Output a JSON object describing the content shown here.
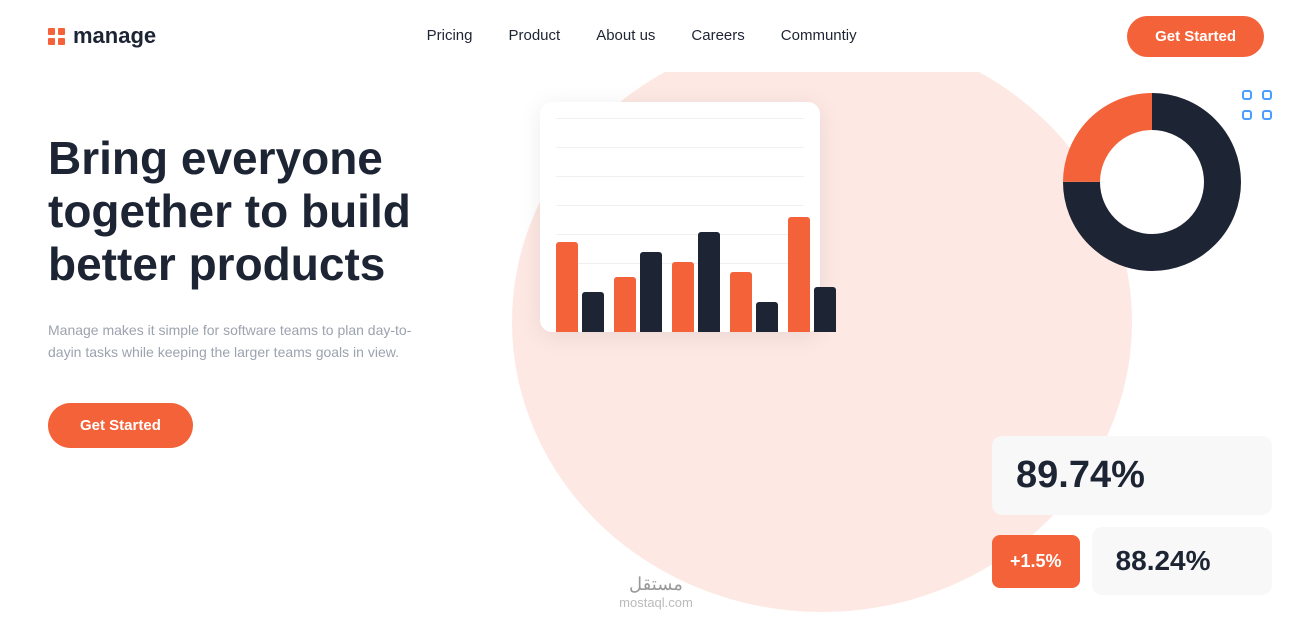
{
  "logo": {
    "text": "manage"
  },
  "navbar": {
    "links": [
      {
        "label": "Pricing",
        "id": "pricing"
      },
      {
        "label": "Product",
        "id": "product"
      },
      {
        "label": "About us",
        "id": "about"
      },
      {
        "label": "Careers",
        "id": "careers"
      },
      {
        "label": "Communtiy",
        "id": "community"
      }
    ],
    "cta_label": "Get Started"
  },
  "hero": {
    "title": "Bring everyone together to build better products",
    "subtitle": "Manage makes it simple for software teams to plan day-to-dayin tasks while keeping the larger teams goals in view.",
    "cta_label": "Get Started"
  },
  "stats": {
    "large_value": "89.74%",
    "badge_value": "+1.5%",
    "secondary_value": "88.24%"
  },
  "watermark": {
    "line1": "مستقل",
    "line2": "mostaql.com"
  },
  "colors": {
    "orange": "#f4623a",
    "navy": "#1d2433",
    "blob_bg": "#fde8e3"
  }
}
